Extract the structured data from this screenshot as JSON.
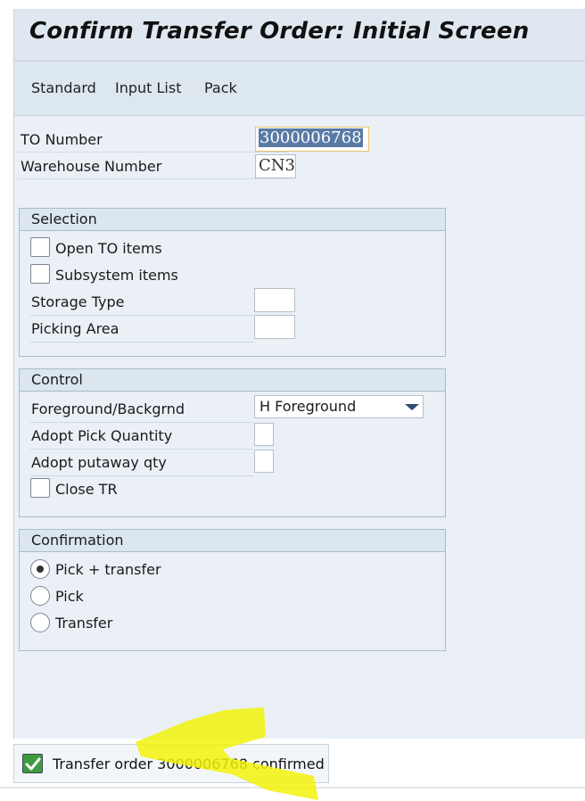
{
  "title": "Confirm Transfer Order: Initial Screen",
  "toolbar": {
    "items": [
      "Standard",
      "Input List",
      "Pack"
    ]
  },
  "header_fields": {
    "to_number": {
      "label": "TO Number",
      "value": "3000006768"
    },
    "warehouse_number": {
      "label": "Warehouse Number",
      "value": "CN3"
    }
  },
  "selection": {
    "title": "Selection",
    "open_to_items": {
      "label": "Open TO items",
      "checked": false
    },
    "subsystem_items": {
      "label": "Subsystem items",
      "checked": false
    },
    "storage_type": {
      "label": "Storage Type",
      "value": ""
    },
    "picking_area": {
      "label": "Picking Area",
      "value": ""
    }
  },
  "control": {
    "title": "Control",
    "foreground": {
      "label": "Foreground/Backgrnd",
      "value": "H Foreground"
    },
    "adopt_pick_qty": {
      "label": "Adopt Pick Quantity",
      "value": ""
    },
    "adopt_putaway_qty": {
      "label": "Adopt putaway qty",
      "value": ""
    },
    "close_tr": {
      "label": "Close TR",
      "checked": false
    }
  },
  "confirmation": {
    "title": "Confirmation",
    "options": [
      "Pick + transfer",
      "Pick",
      "Transfer"
    ],
    "selected": "Pick + transfer"
  },
  "status": {
    "text": "Transfer order 3000006768 confirmed",
    "icon": "success-check-icon"
  },
  "colors": {
    "annotation_highlight": "#f2f20a",
    "status_ok": "#3e9a3e"
  }
}
